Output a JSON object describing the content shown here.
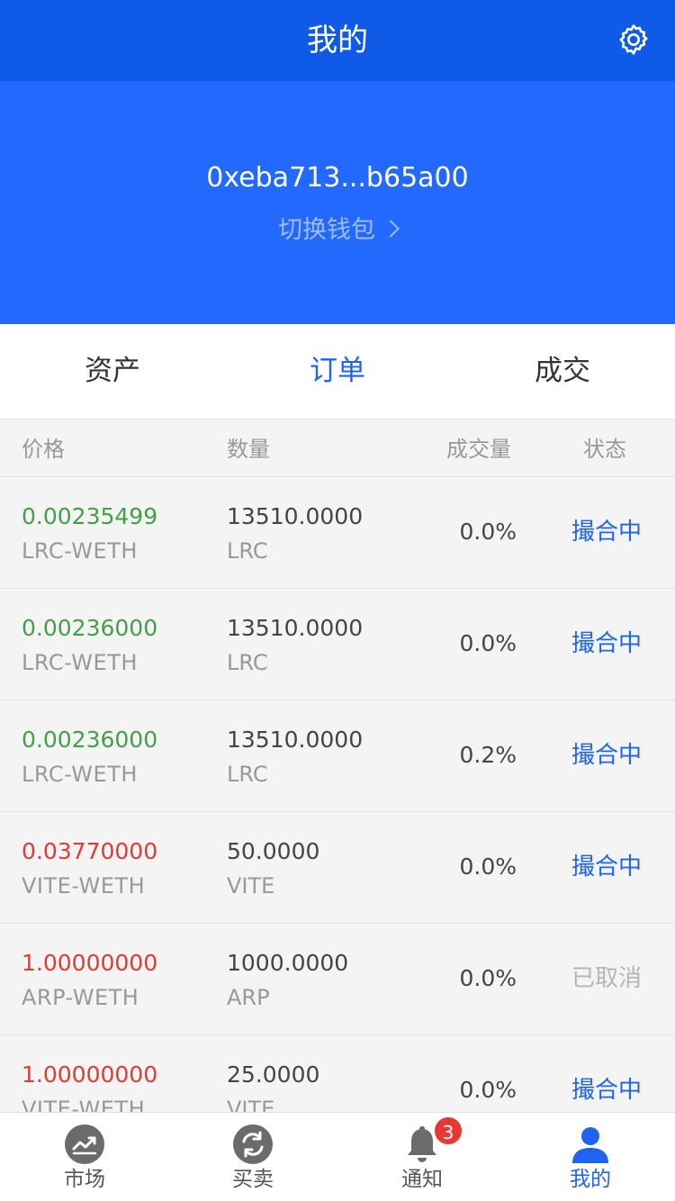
{
  "header": {
    "title": "我的",
    "settings_icon": "gear-icon"
  },
  "wallet": {
    "address": "0xeba713...b65a00",
    "switch_label": "切换钱包"
  },
  "tabs": [
    {
      "label": "资产",
      "active": false
    },
    {
      "label": "订单",
      "active": true
    },
    {
      "label": "成交",
      "active": false
    }
  ],
  "table": {
    "headers": {
      "price": "价格",
      "quantity": "数量",
      "filled": "成交量",
      "status": "状态"
    },
    "rows": [
      {
        "price": "0.00235499",
        "price_color": "green",
        "pair": "LRC-WETH",
        "quantity": "13510.0000",
        "unit": "LRC",
        "filled": "0.0%",
        "status": "撮合中",
        "status_color": "blue"
      },
      {
        "price": "0.00236000",
        "price_color": "green",
        "pair": "LRC-WETH",
        "quantity": "13510.0000",
        "unit": "LRC",
        "filled": "0.0%",
        "status": "撮合中",
        "status_color": "blue"
      },
      {
        "price": "0.00236000",
        "price_color": "green",
        "pair": "LRC-WETH",
        "quantity": "13510.0000",
        "unit": "LRC",
        "filled": "0.2%",
        "status": "撮合中",
        "status_color": "blue"
      },
      {
        "price": "0.03770000",
        "price_color": "red",
        "pair": "VITE-WETH",
        "quantity": "50.0000",
        "unit": "VITE",
        "filled": "0.0%",
        "status": "撮合中",
        "status_color": "blue"
      },
      {
        "price": "1.00000000",
        "price_color": "red",
        "pair": "ARP-WETH",
        "quantity": "1000.0000",
        "unit": "ARP",
        "filled": "0.0%",
        "status": "已取消",
        "status_color": "gray"
      },
      {
        "price": "1.00000000",
        "price_color": "red",
        "pair": "VITE-WETH",
        "quantity": "25.0000",
        "unit": "VITE",
        "filled": "0.0%",
        "status": "撮合中",
        "status_color": "blue"
      }
    ]
  },
  "bottom_nav": [
    {
      "label": "市场",
      "icon": "market-trend-icon",
      "active": false
    },
    {
      "label": "买卖",
      "icon": "exchange-icon",
      "active": false
    },
    {
      "label": "通知",
      "icon": "bell-icon",
      "active": false,
      "badge": "3"
    },
    {
      "label": "我的",
      "icon": "user-icon",
      "active": true
    }
  ],
  "colors": {
    "header_bg": "#0f5be8",
    "hero_bg": "#2469fd",
    "accent": "#1f64f0",
    "buy_green": "#43a047",
    "sell_red": "#e53935"
  }
}
